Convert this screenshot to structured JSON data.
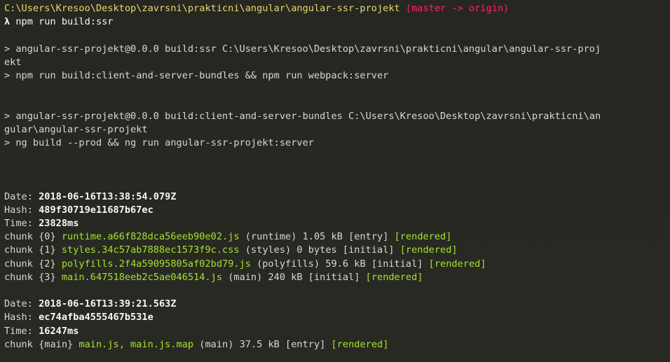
{
  "prompt": {
    "path": "C:\\Users\\Kresoo\\Desktop\\zavrsni\\prakticni\\angular\\angular-ssr-projekt",
    "git": " (master -> origin)",
    "symbol": "λ",
    "command": " npm run build:ssr"
  },
  "output": {
    "script1_line1": "> angular-ssr-projekt@0.0.0 build:ssr C:\\Users\\Kresoo\\Desktop\\zavrsni\\prakticni\\angular\\angular-ssr-proj",
    "script1_line2": "ekt",
    "script1_line3": "> npm run build:client-and-server-bundles && npm run webpack:server",
    "script2_line1": "> angular-ssr-projekt@0.0.0 build:client-and-server-bundles C:\\Users\\Kresoo\\Desktop\\zavrsni\\prakticni\\an",
    "script2_line2": "gular\\angular-ssr-projekt",
    "script2_line3": "> ng build --prod && ng run angular-ssr-projekt:server"
  },
  "build1": {
    "date_label": "Date: ",
    "date": "2018-06-16T13:38:54.079Z",
    "hash_label": "Hash: ",
    "hash": "489f30719e11687b67ec",
    "time_label": "Time: ",
    "time": "23828ms",
    "chunks": [
      {
        "prefix": "chunk ",
        "id": "{0}",
        "file": " runtime.a66f828dca56eeb90e02.js",
        "name": " (runtime) ",
        "size": "1.05 kB",
        "tags": " [entry] ",
        "status": "[rendered]"
      },
      {
        "prefix": "chunk ",
        "id": "{1}",
        "file": " styles.34c57ab7888ec1573f9c.css",
        "name": " (styles) ",
        "size": "0 bytes",
        "tags": " [initial] ",
        "status": "[rendered]"
      },
      {
        "prefix": "chunk ",
        "id": "{2}",
        "file": " polyfills.2f4a59095805af02bd79.js",
        "name": " (polyfills) ",
        "size": "59.6 kB",
        "tags": " [initial] ",
        "status": "[rendered]"
      },
      {
        "prefix": "chunk ",
        "id": "{3}",
        "file": " main.647518eeb2c5ae046514.js",
        "name": " (main) ",
        "size": "240 kB",
        "tags": " [initial] ",
        "status": "[rendered]"
      }
    ]
  },
  "build2": {
    "date_label": "Date: ",
    "date": "2018-06-16T13:39:21.563Z",
    "hash_label": "Hash: ",
    "hash": "ec74afba4555467b531e",
    "time_label": "Time: ",
    "time": "16247ms",
    "chunk": {
      "prefix": "chunk ",
      "id": "{main}",
      "file": " main.js, main.js.map",
      "name": " (main) ",
      "size": "37.5 kB",
      "tags": " [entry] ",
      "status": "[rendered]"
    }
  },
  "colors": {
    "background": "#272822",
    "path": "#e6db74",
    "git": "#f92672",
    "file": "#a6e22e",
    "text": "#d9d9d0"
  }
}
